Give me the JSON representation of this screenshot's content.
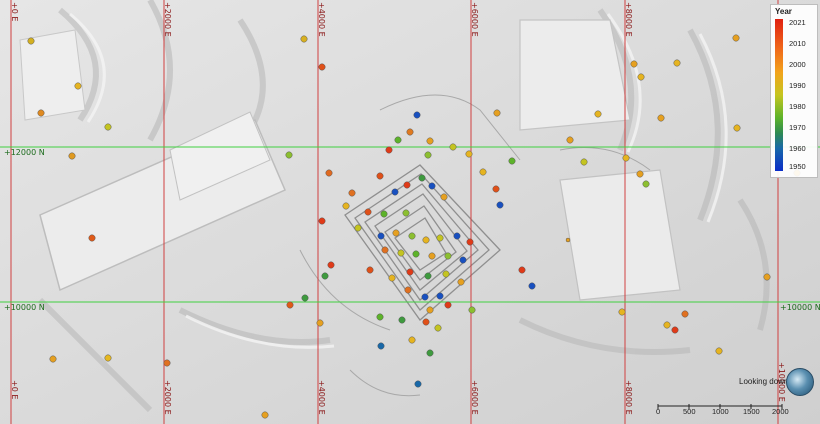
{
  "viewer": {
    "view_label": "Looking down",
    "icons": {
      "compass": "view-orientation-sphere-icon"
    }
  },
  "grid": {
    "easting_labels": [
      "+0 E",
      "+2000 E",
      "+4000 E",
      "+6000 E",
      "+8000 E",
      "+10000 E"
    ],
    "northing_labels": [
      "+12000 N",
      "+10000 N"
    ],
    "colors": {
      "easting_line": "#d04040",
      "northing_line": "#40d040"
    }
  },
  "legend": {
    "title": "Year",
    "ticks": [
      "2021",
      "2010",
      "2000",
      "1990",
      "1980",
      "1970",
      "1960",
      "1950"
    ],
    "gradient": [
      "#e02010",
      "#f06a1a",
      "#f2a31c",
      "#c5c520",
      "#5db32a",
      "#2e8a52",
      "#1868a8",
      "#0a2cc8"
    ]
  },
  "scale_bar": {
    "labels": [
      "0",
      "500",
      "1000",
      "1500",
      "2000"
    ]
  }
}
